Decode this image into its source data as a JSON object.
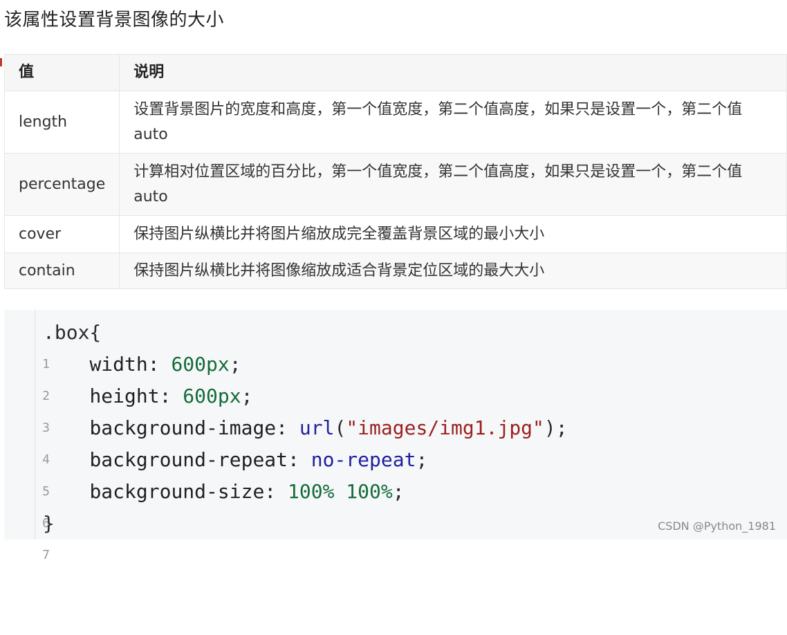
{
  "heading": "该属性设置背景图像的大小",
  "table": {
    "headers": [
      "值",
      "说明"
    ],
    "rows": [
      {
        "value": "length",
        "desc": "设置背景图片的宽度和高度，第一个值宽度，第二个值高度，如果只是设置一个，第二个值auto"
      },
      {
        "value": "percentage",
        "desc": "计算相对位置区域的百分比，第一个值宽度，第二个值高度，如果只是设置一个，第二个值auto"
      },
      {
        "value": "cover",
        "desc": "保持图片纵横比并将图片缩放成完全覆盖背景区域的最小大小"
      },
      {
        "value": "contain",
        "desc": "保持图片纵横比并将图像缩放成适合背景定位区域的最大大小"
      }
    ]
  },
  "code": {
    "line_numbers": [
      "1",
      "2",
      "3",
      "4",
      "5",
      "6",
      "7"
    ],
    "l1": ".box{",
    "l2_prop": "width: ",
    "l2_val": "600px",
    "l2_end": ";",
    "l3_prop": "height: ",
    "l3_val": "600px",
    "l3_end": ";",
    "l4_prop": "background-image: ",
    "l4_func": "url",
    "l4_open": "(",
    "l4_str": "\"images/img1.jpg\"",
    "l4_end": ");",
    "l5_prop": "background-repeat: ",
    "l5_val": "no-repeat",
    "l5_end": ";",
    "l6_prop": "background-size: ",
    "l6_val": "100% 100%",
    "l6_end": ";",
    "l7": "}"
  },
  "watermark": "CSDN @Python_1981"
}
